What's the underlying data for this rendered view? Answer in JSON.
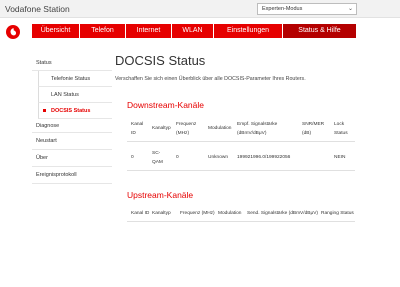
{
  "topbar": {
    "brand": "Vodafone Station",
    "mode_value": "Experten-Modus"
  },
  "colors": {
    "accent": "#e60000",
    "accent_dark": "#b40000"
  },
  "nav": {
    "items": [
      {
        "label": "Übersicht"
      },
      {
        "label": "Telefon"
      },
      {
        "label": "Internet"
      },
      {
        "label": "WLAN"
      },
      {
        "label": "Einstellungen"
      },
      {
        "label": "Status & Hilfe"
      }
    ]
  },
  "sidebar": {
    "items": [
      {
        "label": "Status"
      },
      {
        "label": "Telefonie Status"
      },
      {
        "label": "LAN Status"
      },
      {
        "label": "DOCSIS Status"
      },
      {
        "label": "Diagnose"
      },
      {
        "label": "Neustart"
      },
      {
        "label": "Über"
      },
      {
        "label": "Ereignisprotokoll"
      }
    ]
  },
  "main": {
    "title": "DOCSIS Status",
    "intro": "Verschaffen Sie sich einen Überblick über alle DOCSIS-Parameter Ihres Routers.",
    "downstream": {
      "title": "Downstream-Kanäle",
      "headers": [
        "Kanal ID",
        "Kanaltyp",
        "Frequenz (MHz)",
        "Modulation",
        "Empf. Signalstärke (dBmV/dBμV)",
        "SNR/MER (dB)",
        "Lock Status"
      ],
      "row": [
        "0",
        "SC-QAM",
        "0",
        "Unknown",
        "199921996.0/199922056",
        "",
        "NEIN"
      ]
    },
    "upstream": {
      "title": "Upstream-Kanäle",
      "headers": [
        "Kanal ID",
        "Kanaltyp",
        "Frequenz (MHz)",
        "Modulation",
        "Send. Signalstärke (dBmV/dBμV)",
        "Ranging Status"
      ]
    }
  }
}
